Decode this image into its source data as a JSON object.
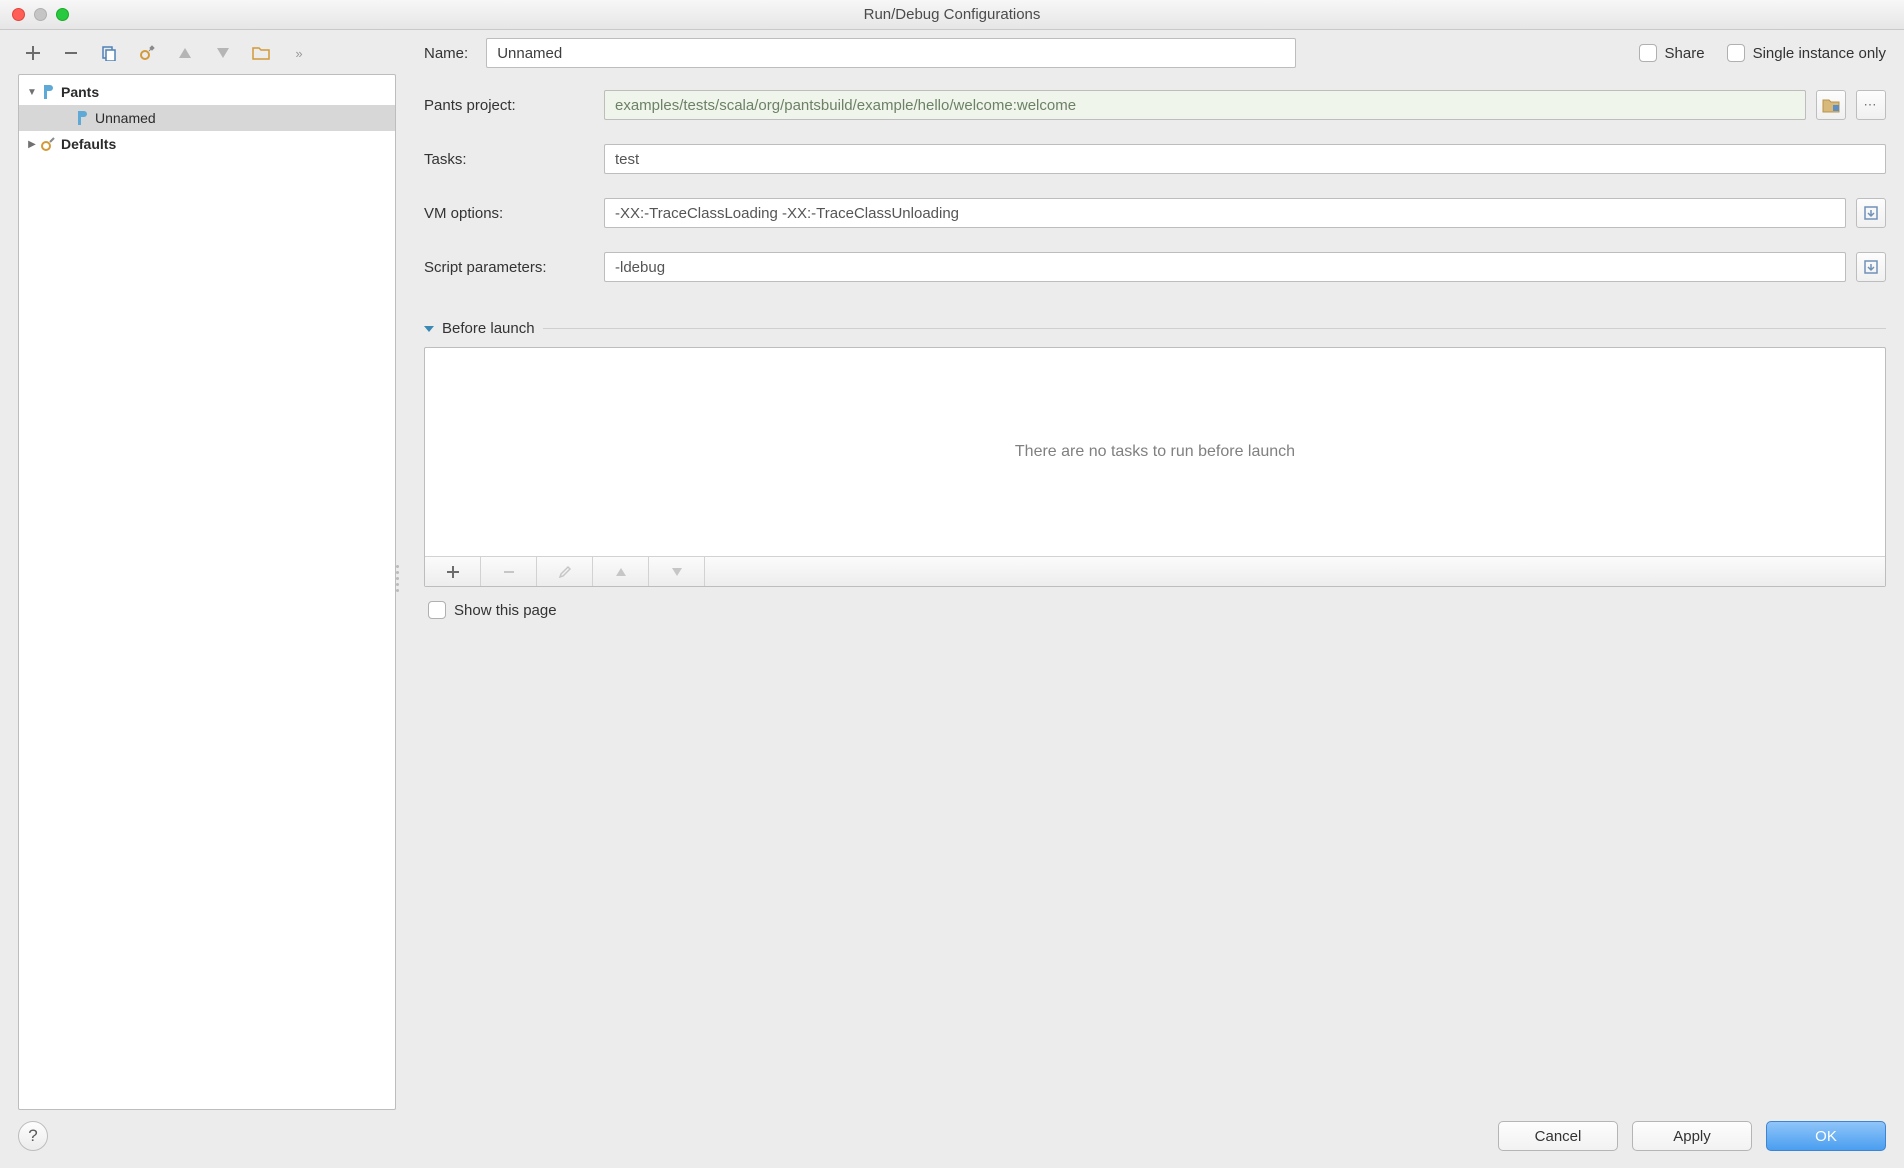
{
  "window": {
    "title": "Run/Debug Configurations"
  },
  "tree": {
    "items": {
      "pants": "Pants",
      "unnamed": "Unnamed",
      "defaults": "Defaults"
    }
  },
  "form": {
    "name_label": "Name:",
    "name_value": "Unnamed",
    "share_label": "Share",
    "single_instance_label": "Single instance only",
    "pants_project_label": "Pants project:",
    "pants_project_value": "examples/tests/scala/org/pantsbuild/example/hello/welcome:welcome",
    "tasks_label": "Tasks:",
    "tasks_value": "test",
    "vm_label": "VM options:",
    "vm_value": "-XX:-TraceClassLoading -XX:-TraceClassUnloading",
    "script_label": "Script parameters:",
    "script_value": "-ldebug",
    "before_launch_label": "Before launch",
    "before_empty": "There are no tasks to run before launch",
    "show_page_label": "Show this page"
  },
  "footer": {
    "cancel": "Cancel",
    "apply": "Apply",
    "ok": "OK"
  }
}
